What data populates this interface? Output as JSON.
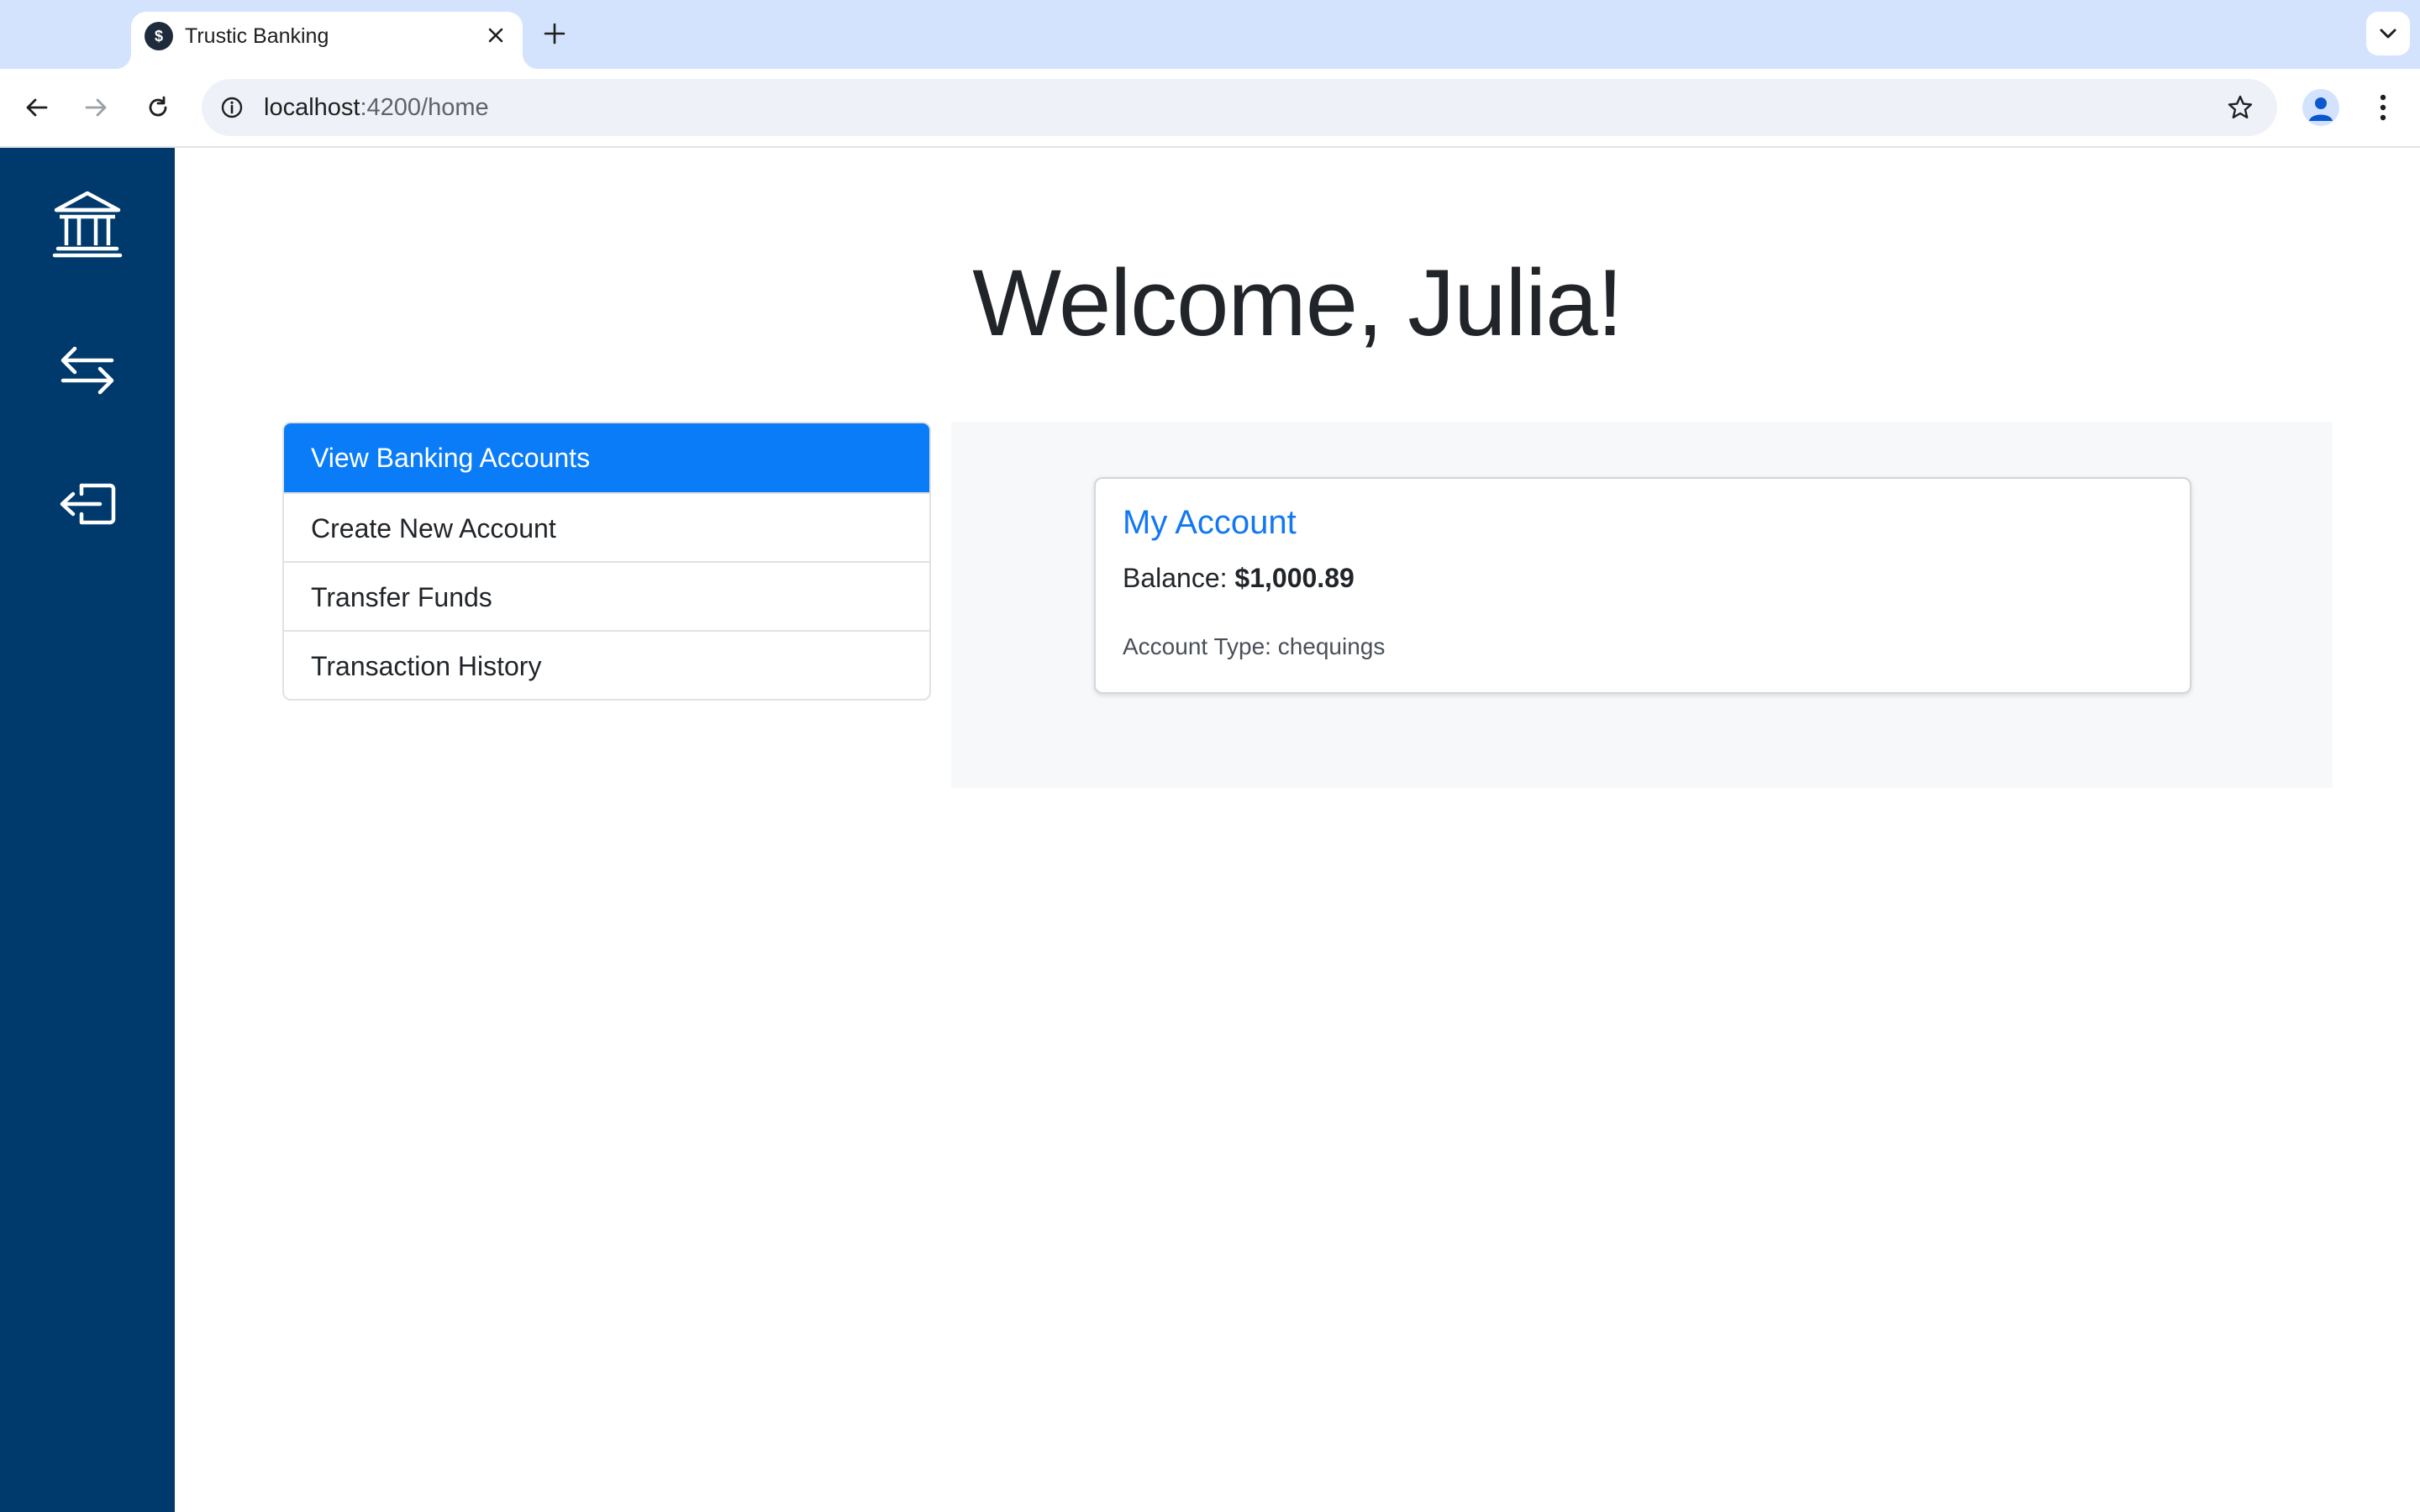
{
  "browser": {
    "tab_title": "Trustic Banking",
    "favicon_glyph": "$",
    "url_host": "localhost",
    "url_rest": ":4200/home"
  },
  "sidebar": {
    "items": [
      {
        "icon": "bank-icon"
      },
      {
        "icon": "transfer-arrows-icon"
      },
      {
        "icon": "logout-icon"
      }
    ]
  },
  "main": {
    "welcome": "Welcome, Julia!",
    "menu": [
      {
        "label": "View Banking Accounts",
        "active": true
      },
      {
        "label": "Create New Account",
        "active": false
      },
      {
        "label": "Transfer Funds",
        "active": false
      },
      {
        "label": "Transaction History",
        "active": false
      }
    ],
    "account": {
      "title": "My Account",
      "balance_label": "Balance:",
      "balance_value": "$1,000.89",
      "type_text": "Account Type: chequings"
    }
  },
  "colors": {
    "sidebar": "#003a6c",
    "active": "#0a7cf8",
    "link": "#1278f2"
  }
}
